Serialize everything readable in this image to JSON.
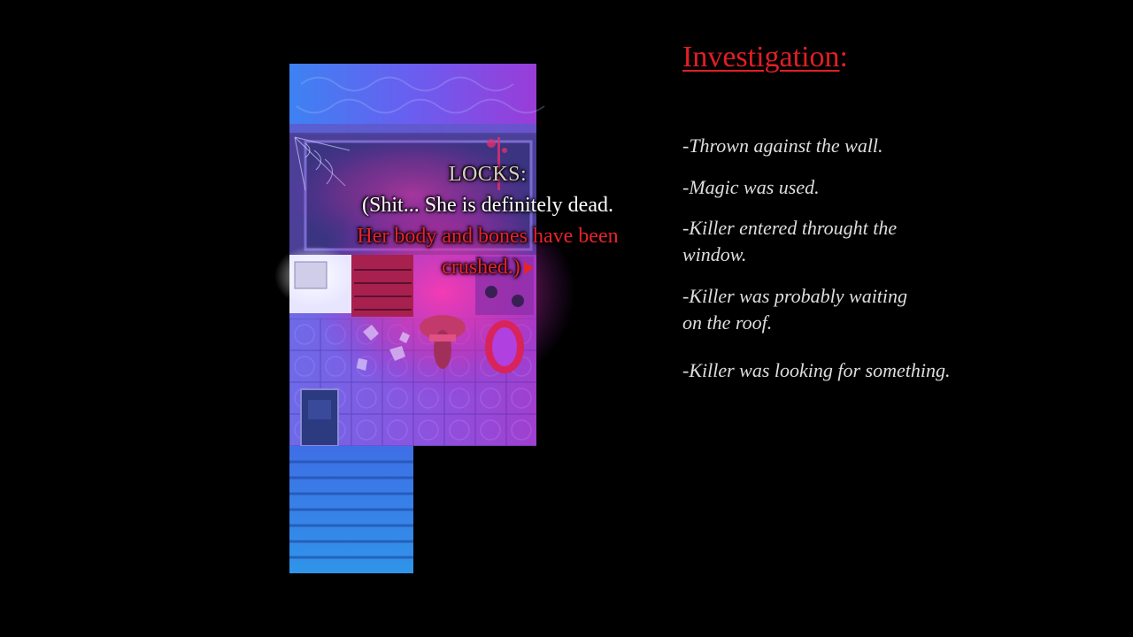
{
  "dialogue": {
    "speaker": "LOCKS:",
    "line1": "(Shit... She is definitely dead.",
    "line2": "Her body and bones have been",
    "line3": "crushed.)"
  },
  "investigation": {
    "title": "Investigation",
    "colon": ":",
    "clues": [
      "-Thrown against the wall.",
      "-Magic was used.",
      "-Killer entered throught the window.",
      "-Killer was probably waiting on the roof.",
      "-Killer was looking for something."
    ]
  },
  "colors": {
    "accent_red": "#e01f23",
    "map_purple": "#8a4cf0",
    "map_blue": "#2f8fe8",
    "map_pink": "#ff2fa8"
  }
}
